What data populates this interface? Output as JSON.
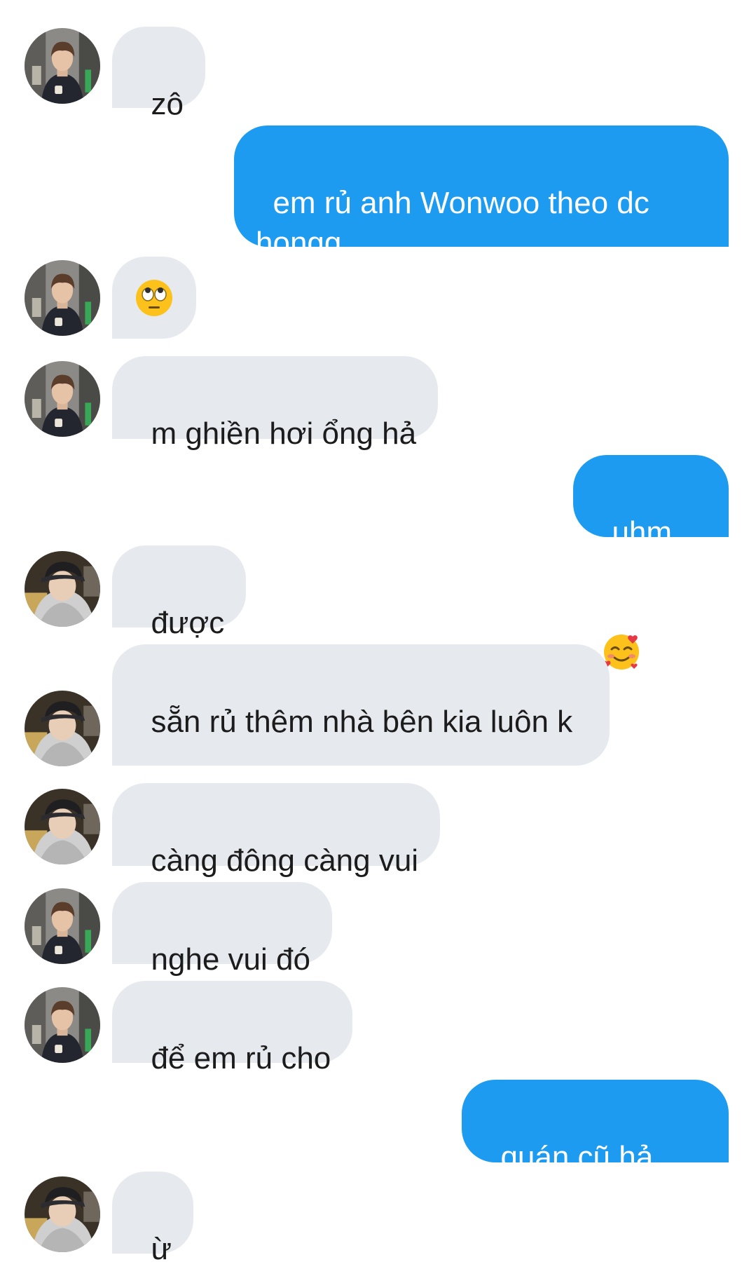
{
  "conversation": {
    "messages": [
      {
        "side": "in",
        "avatar": "avatar-a",
        "text": "zô"
      },
      {
        "side": "out",
        "text": "em rủ anh Wonwoo theo dc hongg"
      },
      {
        "side": "in",
        "avatar": "avatar-a",
        "emoji": "face-with-rolling-eyes-emoji",
        "text": ""
      },
      {
        "side": "in",
        "avatar": "avatar-a",
        "text": "m ghiền hơi ổng hả"
      },
      {
        "side": "out",
        "text": "uhm",
        "emoji": "smiling-face-with-hearts-emoji"
      },
      {
        "side": "in",
        "avatar": "avatar-b",
        "text": "được"
      },
      {
        "side": "in",
        "avatar": "avatar-b",
        "text": "sẵn rủ thêm nhà bên kia luôn k"
      },
      {
        "side": "in",
        "avatar": "avatar-b",
        "text": "càng đông càng vui"
      },
      {
        "side": "in",
        "avatar": "avatar-a",
        "text": "nghe vui đó"
      },
      {
        "side": "in",
        "avatar": "avatar-a",
        "text": "để em rủ cho"
      },
      {
        "side": "out",
        "text": "quán cũ hả anh"
      },
      {
        "side": "in",
        "avatar": "avatar-b",
        "text": "ừ"
      }
    ]
  },
  "colors": {
    "incoming_bubble": "#e6eaef",
    "outgoing_bubble": "#1d9bf0",
    "incoming_text": "#1c1c1c",
    "outgoing_text": "#ffffff",
    "background": "#ffffff"
  }
}
